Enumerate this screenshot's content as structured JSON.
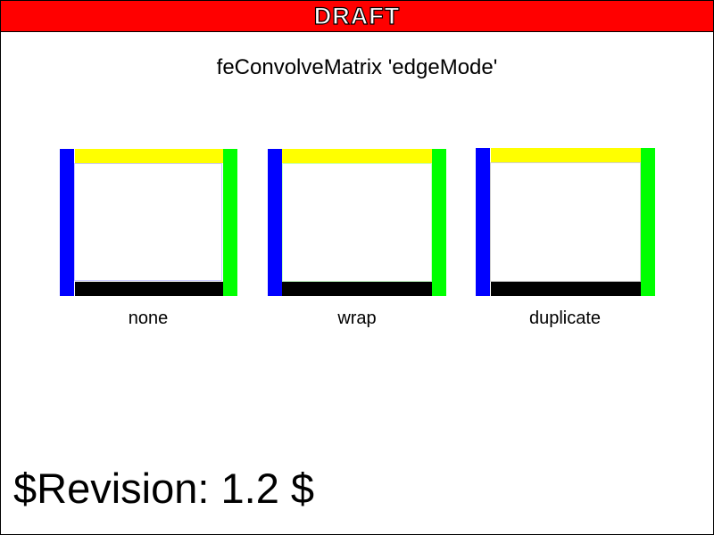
{
  "banner": {
    "text": "DRAFT",
    "color": "#ff0000"
  },
  "title": "feConvolveMatrix 'edgeMode'",
  "panels": [
    {
      "label": "none"
    },
    {
      "label": "wrap"
    },
    {
      "label": "duplicate"
    }
  ],
  "edge_colors": {
    "left": "#0000ff",
    "top": "#ffff00",
    "right": "#00ff00",
    "bottom": "#000000"
  },
  "revision": "$Revision: 1.2 $"
}
